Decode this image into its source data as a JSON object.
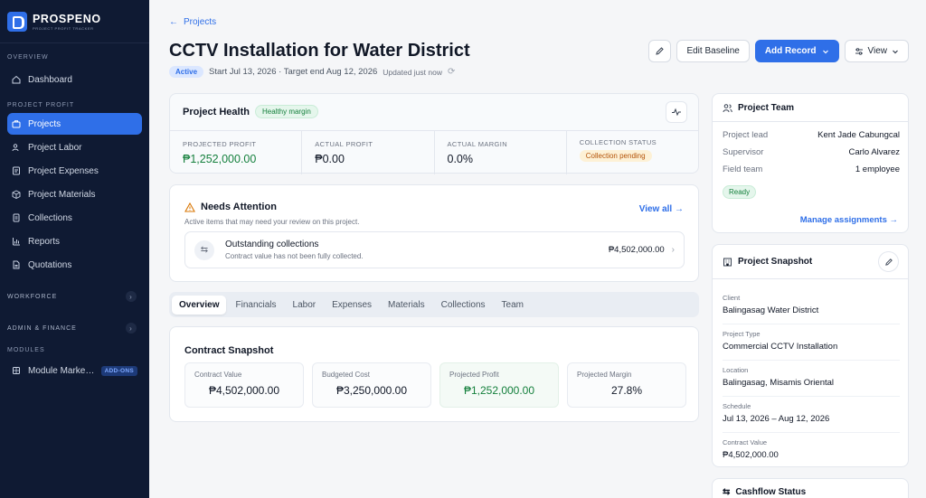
{
  "brand": {
    "name": "PROSPENO",
    "tagline": "PROJECT PROFIT TRACKER"
  },
  "sidebar": {
    "overview_label": "OVERVIEW",
    "dashboard": "Dashboard",
    "project_profit_label": "PROJECT PROFIT",
    "items": [
      {
        "label": "Projects",
        "icon": "briefcase-icon",
        "active": true
      },
      {
        "label": "Project Labor",
        "icon": "people-icon"
      },
      {
        "label": "Project Expenses",
        "icon": "receipt-icon"
      },
      {
        "label": "Project Materials",
        "icon": "box-icon"
      },
      {
        "label": "Collections",
        "icon": "document-icon"
      },
      {
        "label": "Reports",
        "icon": "bar-chart-icon"
      },
      {
        "label": "Quotations",
        "icon": "file-icon"
      }
    ],
    "workforce": "WORKFORCE",
    "admin_finance": "ADMIN & FINANCE",
    "modules_label": "MODULES",
    "module_market": "Module Marke…",
    "addons_badge": "ADD-ONS"
  },
  "header": {
    "back_label": "Projects",
    "title": "CCTV Installation for Water District",
    "status": "Active",
    "dates": "Start Jul 13, 2026 · Target end Aug 12, 2026",
    "updated": "Updated just now",
    "edit_baseline": "Edit Baseline",
    "add_record": "Add Record",
    "view": "View"
  },
  "health": {
    "title": "Project Health",
    "badge": "Healthy margin",
    "metrics": [
      {
        "label": "PROJECTED PROFIT",
        "value": "₱1,252,000.00"
      },
      {
        "label": "ACTUAL PROFIT",
        "value": "₱0.00"
      },
      {
        "label": "ACTUAL MARGIN",
        "value": "0.0%"
      },
      {
        "label": "COLLECTION STATUS",
        "value": "Collection pending"
      }
    ]
  },
  "attention": {
    "title": "Needs Attention",
    "subtitle": "Active items that may need your review on this project.",
    "view_all": "View all",
    "item": {
      "title": "Outstanding collections",
      "desc": "Contract value has not been fully collected.",
      "amount": "₱4,502,000.00"
    }
  },
  "tabs": [
    "Overview",
    "Financials",
    "Labor",
    "Expenses",
    "Materials",
    "Collections",
    "Team"
  ],
  "contract": {
    "title": "Contract Snapshot",
    "boxes": [
      {
        "label": "Contract Value",
        "value": "₱4,502,000.00"
      },
      {
        "label": "Budgeted Cost",
        "value": "₱3,250,000.00"
      },
      {
        "label": "Projected Profit",
        "value": "₱1,252,000.00"
      },
      {
        "label": "Projected Margin",
        "value": "27.8%"
      }
    ]
  },
  "team": {
    "title": "Project Team",
    "rows": [
      {
        "k": "Project lead",
        "v": "Kent Jade Cabungcal"
      },
      {
        "k": "Supervisor",
        "v": "Carlo Alvarez"
      },
      {
        "k": "Field team",
        "v": "1 employee"
      }
    ],
    "status": "Ready",
    "manage": "Manage assignments"
  },
  "snapshot": {
    "title": "Project Snapshot",
    "fields": [
      {
        "label": "Client",
        "value": "Balingasag Water District"
      },
      {
        "label": "Project Type",
        "value": "Commercial CCTV Installation"
      },
      {
        "label": "Location",
        "value": "Balingasag, Misamis Oriental"
      },
      {
        "label": "Schedule",
        "value": "Jul 13, 2026 – Aug 12, 2026"
      },
      {
        "label": "Contract Value",
        "value": "₱4,502,000.00"
      }
    ]
  },
  "cashflow": {
    "title": "Cashflow Status"
  },
  "colors": {
    "accent": "#2f6fe8",
    "sidebar": "#0f1a33",
    "positive": "#15803d",
    "warning": "#b45309"
  }
}
